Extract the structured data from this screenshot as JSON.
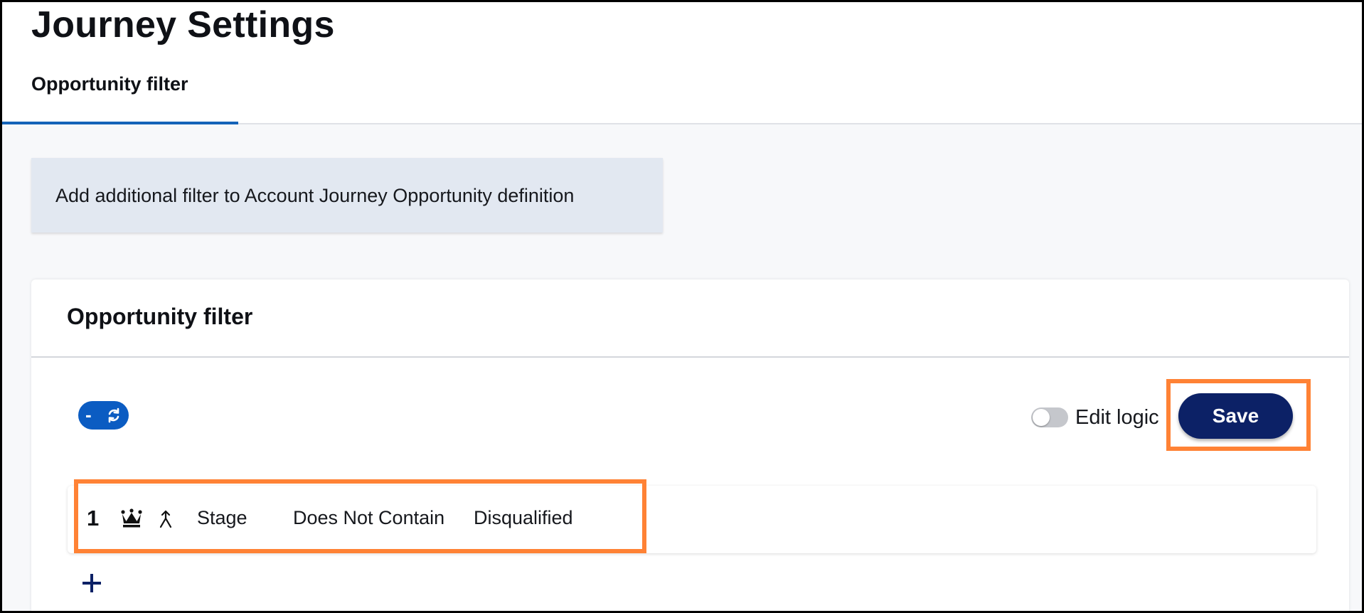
{
  "header": {
    "title": "Journey Settings",
    "tabs": [
      {
        "label": "Opportunity filter",
        "active": true
      }
    ]
  },
  "info_banner": {
    "text": "Add additional filter to Account Journey Opportunity definition"
  },
  "card": {
    "title": "Opportunity filter",
    "logic_pill": {
      "minus_symbol": "-",
      "icon": "refresh-icon"
    },
    "edit_logic": {
      "label": "Edit logic",
      "enabled": false
    },
    "save_label": "Save",
    "rows": [
      {
        "index": "1",
        "icons": [
          "crown-icon",
          "merge-icon"
        ],
        "field": "Stage",
        "operator": "Does Not Contain",
        "value": "Disqualified"
      }
    ],
    "add_icon": "plus-icon"
  },
  "colors": {
    "primary_button": "#0c2166",
    "tab_underline": "#1463b8",
    "logic_pill": "#0b5cc2",
    "highlight": "#ff8235",
    "banner_bg": "#e2e8f1"
  }
}
